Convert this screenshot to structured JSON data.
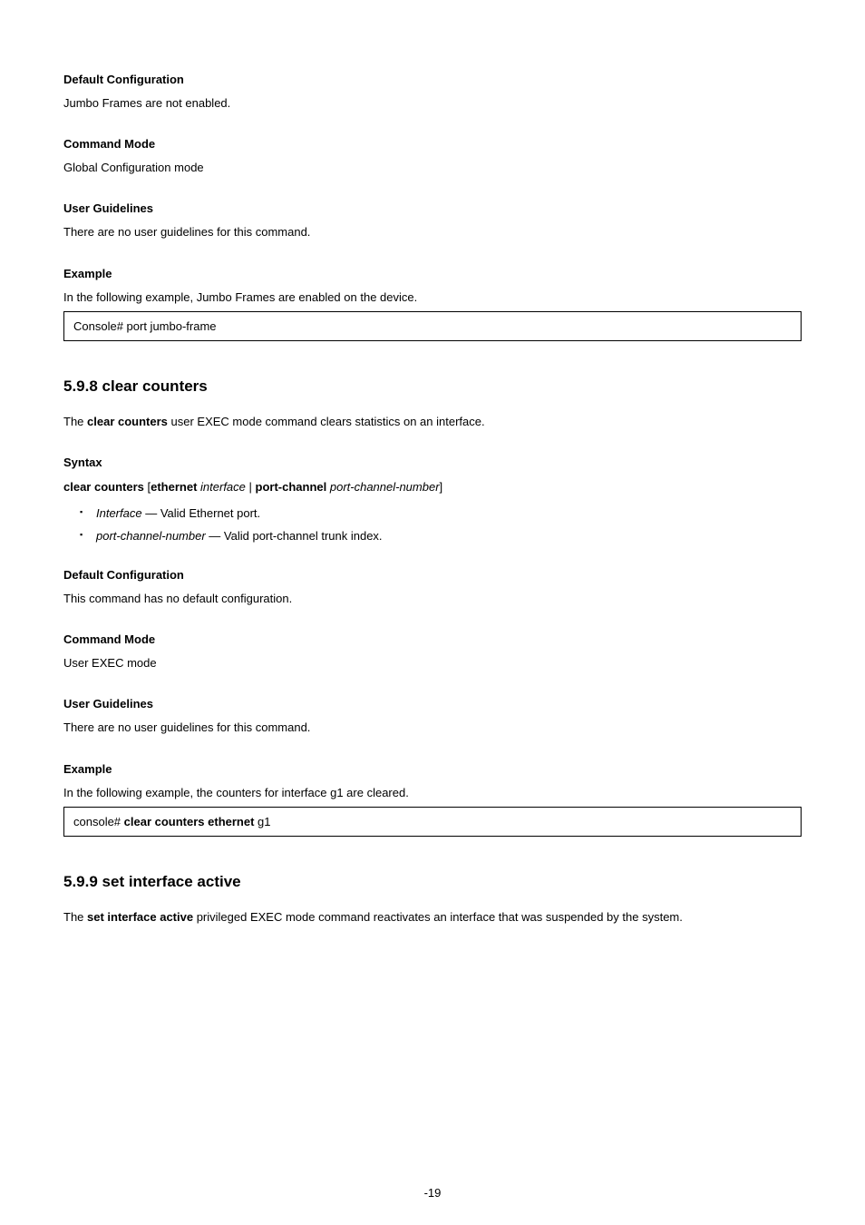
{
  "s1": {
    "heading": "Default Configuration",
    "body": "Jumbo Frames are not enabled."
  },
  "s2": {
    "heading": "Command Mode",
    "body": "Global Configuration mode"
  },
  "s3": {
    "heading": "User Guidelines",
    "body": "There are no user guidelines for this command."
  },
  "s4": {
    "heading": "Example",
    "body": "In the following example, Jumbo Frames are enabled on the device.",
    "console": "Console# port jumbo-frame"
  },
  "cc": {
    "title": "5.9.8 clear counters",
    "pre": "The ",
    "cmd": "clear counters",
    "post": " user EXEC mode command clears statistics on an interface."
  },
  "syn": {
    "heading": "Syntax",
    "cmd": "clear counters ",
    "lb": "[",
    "kw1": "ethernet ",
    "arg1": "interface ",
    "pipe": "| ",
    "kw2": "port-channel ",
    "arg2": "port-channel-number",
    "rb": "]",
    "p1_label": "Interface — ",
    "p1_desc": "Valid Ethernet port.",
    "p2_label": "port-channel-number — ",
    "p2_desc": "Valid port-channel trunk index."
  },
  "s5": {
    "heading": "Default Configuration",
    "body": "This command has no default configuration."
  },
  "s6": {
    "heading": "Command Mode",
    "body": "User EXEC mode"
  },
  "s7": {
    "heading": "User Guidelines",
    "body": "There are no user guidelines for this command."
  },
  "s8": {
    "heading": "Example",
    "body": "In the following example, the counters for interface g1 are cleared.",
    "c_pre": "console# ",
    "c_cmd": "clear counters ethernet ",
    "c_arg": "g1"
  },
  "ss": {
    "title": "5.9.9 set interface active",
    "pre": "The ",
    "cmd": "set interface active",
    "post": " privileged EXEC mode command reactivates an interface that was suspended by the system."
  },
  "page": "-19"
}
